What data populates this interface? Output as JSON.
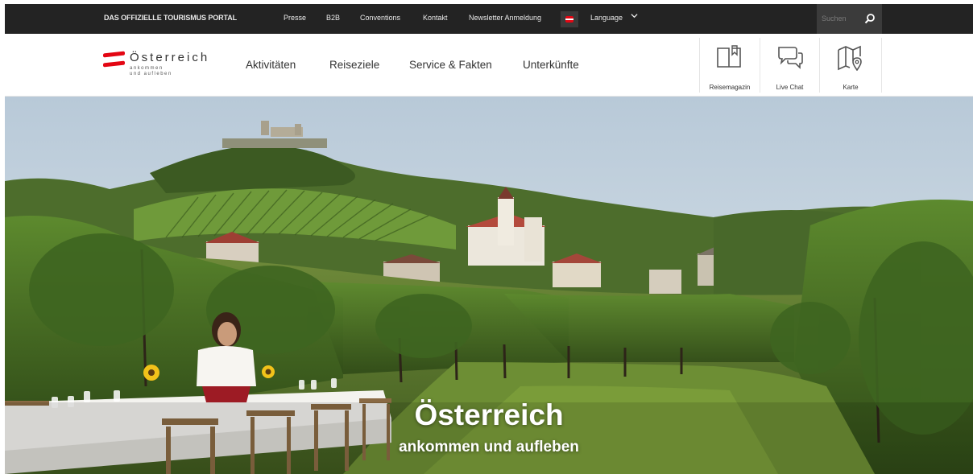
{
  "topbar": {
    "brand": "DAS OFFIZIELLE TOURISMUS PORTAL",
    "links": [
      "Presse",
      "B2B",
      "Conventions",
      "Kontakt",
      "Newsletter Anmeldung"
    ],
    "language": "Language",
    "search_placeholder": "Suchen",
    "icons": {
      "flag": "austria-flag-icon",
      "chevron": "chevron-down-icon",
      "search": "search-icon"
    }
  },
  "logo": {
    "name": "Österreich",
    "tagline_1": "ankommen",
    "tagline_2": "und aufleben"
  },
  "nav": {
    "items": [
      "Aktivitäten",
      "Reiseziele",
      "Service & Fakten",
      "Unterkünfte"
    ]
  },
  "quick": [
    {
      "label": "Reisemagazin",
      "icon": "book-icon"
    },
    {
      "label": "Live Chat",
      "icon": "chat-bubbles-icon"
    },
    {
      "label": "Karte",
      "icon": "map-pin-icon"
    }
  ],
  "hero": {
    "title": "Österreich",
    "subtitle": "ankommen und aufleben"
  },
  "colors": {
    "topbar_bg": "#232323",
    "brand_red": "#e30613",
    "text_dark": "#333333"
  }
}
